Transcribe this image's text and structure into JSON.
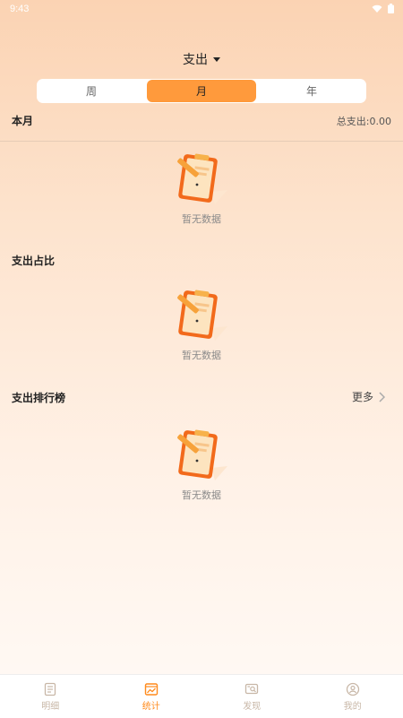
{
  "status_bar": {
    "time": "9:43"
  },
  "header": {
    "title": "支出",
    "dropdown_icon": "caret-down-icon"
  },
  "period_tabs": [
    {
      "label": "周",
      "active": false
    },
    {
      "label": "月",
      "active": true
    },
    {
      "label": "年",
      "active": false
    }
  ],
  "summary": {
    "period_label": "本月",
    "total_text": "总支出:0.00"
  },
  "sections": {
    "monthly_empty": "暂无数据",
    "ratio_title": "支出占比",
    "ratio_empty": "暂无数据",
    "ranking_title": "支出排行榜",
    "ranking_more": "更多",
    "ranking_empty": "暂无数据"
  },
  "tabbar": {
    "items": [
      {
        "label": "明细",
        "icon": "ledger-icon",
        "active": false
      },
      {
        "label": "统计",
        "icon": "chart-icon",
        "active": true
      },
      {
        "label": "发现",
        "icon": "discover-icon",
        "active": false
      },
      {
        "label": "我的",
        "icon": "profile-icon",
        "active": false
      }
    ]
  },
  "colors": {
    "accent": "#ff9a3c",
    "accent_text": "#ff8a1c",
    "inactive_tab": "#c8b7a7",
    "background_top": "#fbd3b3",
    "background_bottom": "#fffaf6"
  }
}
